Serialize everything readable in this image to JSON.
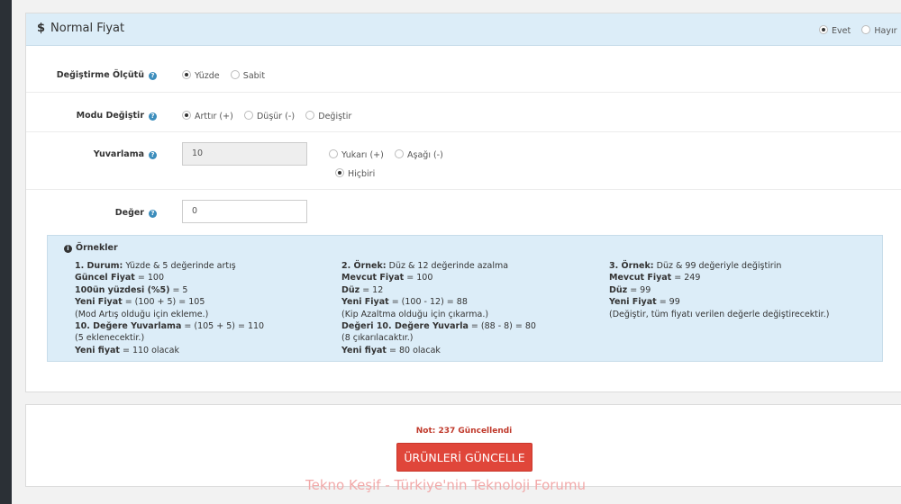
{
  "panel": {
    "icon": "dollar-icon",
    "title": "Normal Fiyat",
    "toggle": [
      {
        "label": "Evet",
        "checked": true
      },
      {
        "label": "Hayır",
        "checked": false
      }
    ]
  },
  "form": {
    "criteria": {
      "label": "Değiştirme Ölçütü",
      "options": [
        {
          "label": "Yüzde",
          "checked": true
        },
        {
          "label": "Sabit",
          "checked": false
        }
      ]
    },
    "mode": {
      "label": "Modu Değiştir",
      "options": [
        {
          "label": "Arttır (+)",
          "checked": true
        },
        {
          "label": "Düşür (-)",
          "checked": false
        },
        {
          "label": "Değiştir",
          "checked": false
        }
      ]
    },
    "rounding": {
      "label": "Yuvarlama",
      "value": "10",
      "options": [
        {
          "label": "Yukarı (+)",
          "checked": false
        },
        {
          "label": "Aşağı (-)",
          "checked": false
        },
        {
          "label": "Hiçbiri",
          "checked": true
        }
      ]
    },
    "value": {
      "label": "Değer",
      "value": "0"
    }
  },
  "examples": {
    "title": "Örnekler",
    "columns": [
      [
        {
          "bold": "1. Durum:",
          "text": " Yüzde & 5 değerinde artış"
        },
        {
          "bold": "Güncel Fiyat",
          "text": " = 100"
        },
        {
          "bold": "100ün yüzdesi (%5)",
          "text": " = 5"
        },
        {
          "bold": "Yeni Fiyat",
          "text": " = (100 + 5) = 105"
        },
        {
          "bold": "",
          "text": "(Mod Artış olduğu için ekleme.)"
        },
        {
          "bold": "10. Değere Yuvarlama",
          "text": " = (105 + 5) = 110"
        },
        {
          "bold": "",
          "text": "(5 eklenecektir.)"
        },
        {
          "bold": "Yeni fiyat",
          "text": " = 110 olacak"
        }
      ],
      [
        {
          "bold": "2. Örnek:",
          "text": " Düz & 12 değerinde azalma"
        },
        {
          "bold": "Mevcut Fiyat",
          "text": " = 100"
        },
        {
          "bold": "Düz",
          "text": " = 12"
        },
        {
          "bold": "Yeni Fiyat",
          "text": " = (100 - 12) = 88"
        },
        {
          "bold": "",
          "text": "(Kip Azaltma olduğu için çıkarma.)"
        },
        {
          "bold": "Değeri 10. Değere Yuvarla",
          "text": " = (88 - 8) = 80"
        },
        {
          "bold": "",
          "text": "(8 çıkarılacaktır.)"
        },
        {
          "bold": "Yeni fiyat",
          "text": " = 80 olacak"
        }
      ],
      [
        {
          "bold": "3. Örnek:",
          "text": " Düz & 99 değeriyle değiştirin"
        },
        {
          "bold": "Mevcut Fiyat",
          "text": " = 249"
        },
        {
          "bold": "Düz",
          "text": " = 99"
        },
        {
          "bold": "Yeni Fiyat",
          "text": " = 99"
        },
        {
          "bold": "",
          "text": "(Değiştir, tüm fiyatı verilen değerle değiştirecektir.)"
        }
      ]
    ]
  },
  "footer": {
    "note": "Not: 237 Güncellendi",
    "button": "ÜRÜNLERİ GÜNCELLE"
  },
  "watermark": "Tekno Keşif - Türkiye'nin Teknoloji Forumu"
}
